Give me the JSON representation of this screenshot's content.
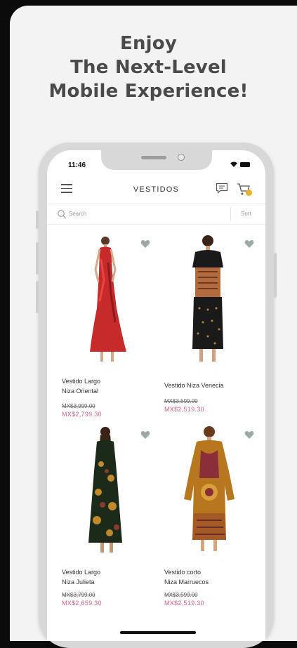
{
  "headline": {
    "line1": "Enjoy",
    "line2": "The Next-Level",
    "line3": "Mobile Experience!"
  },
  "status": {
    "time": "11:46"
  },
  "nav": {
    "title": "VESTIDOS",
    "icons": [
      "menu-icon",
      "chat-icon",
      "cart-icon"
    ]
  },
  "search": {
    "placeholder": "Search",
    "sort_label": "Sort"
  },
  "products": [
    {
      "name_line1": "Vestido Largo",
      "name_line2": "Niza Oriental",
      "old_price": "MX$3,999.00",
      "price": "MX$2,799.30",
      "colors": [
        "#c72a2a",
        "#e8463f"
      ]
    },
    {
      "name_line1": "Vestido Niza Venecia",
      "name_line2": "",
      "old_price": "MX$3,599.00",
      "price": "MX$2,519.30",
      "colors": [
        "#1a1a1a",
        "#b36a3c"
      ]
    },
    {
      "name_line1": "Vestido Largo",
      "name_line2": "Niza Julieta",
      "old_price": "MX$3,799.00",
      "price": "MX$2,659.30",
      "colors": [
        "#1c2a1a",
        "#c08a2c"
      ]
    },
    {
      "name_line1": "Vestido corto",
      "name_line2": "Niza Marruecos",
      "old_price": "MX$3,599.00",
      "price": "MX$2,519.30",
      "colors": [
        "#b8761e",
        "#8a2f3a"
      ]
    }
  ],
  "colors": {
    "accent_price": "#d9627d",
    "cart_badge": "#f2b21c"
  }
}
